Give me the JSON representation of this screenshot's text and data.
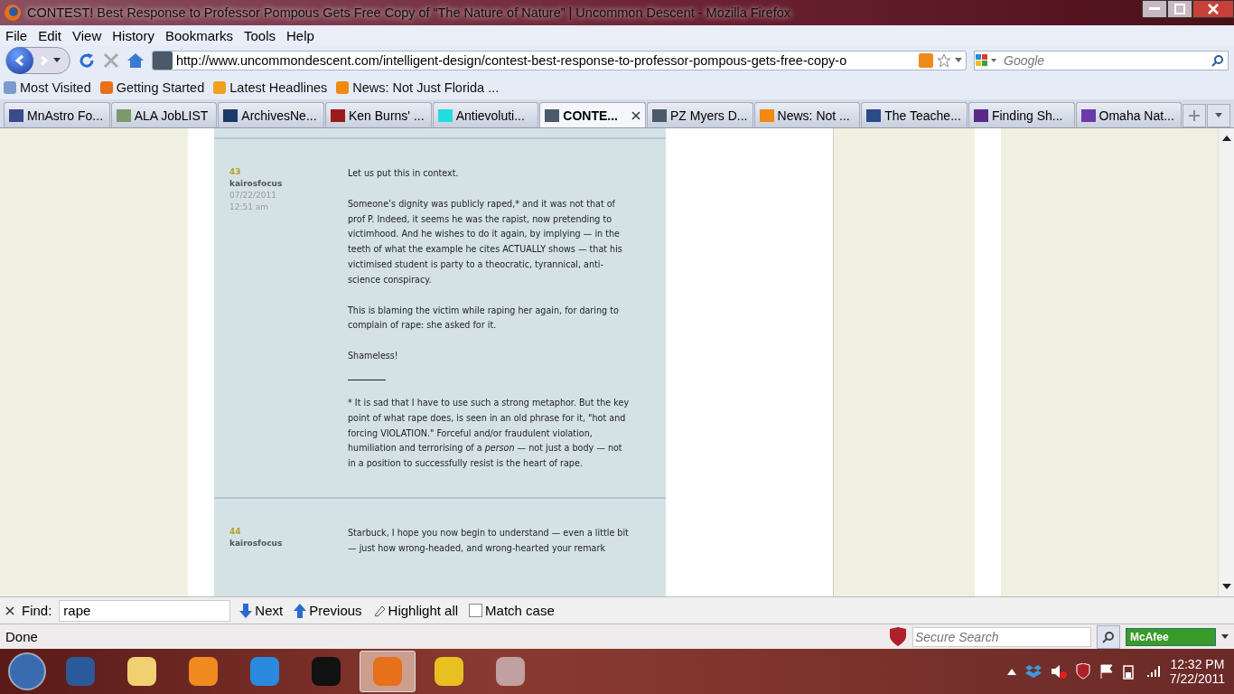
{
  "window": {
    "title": "CONTEST! Best Response to Professor Pompous Gets Free Copy of “The Nature of Nature” | Uncommon Descent - Mozilla Firefox"
  },
  "menu": [
    "File",
    "Edit",
    "View",
    "History",
    "Bookmarks",
    "Tools",
    "Help"
  ],
  "address": {
    "url": "http://www.uncommondescent.com/intelligent-design/contest-best-response-to-professor-pompous-gets-free-copy-o"
  },
  "search": {
    "placeholder": "Google"
  },
  "bookmarks": [
    "Most Visited",
    "Getting Started",
    "Latest Headlines",
    "News: Not Just Florida ..."
  ],
  "tabs": [
    {
      "label": "MnAstro Fo...",
      "selected": false,
      "color": "#3a4a8a"
    },
    {
      "label": "ALA JobLIST",
      "selected": false,
      "color": "#7a9a6a"
    },
    {
      "label": "ArchivesNe...",
      "selected": false,
      "color": "#1a3a6a"
    },
    {
      "label": "Ken Burns' ...",
      "selected": false,
      "color": "#9a1a1a"
    },
    {
      "label": "Antievoluti...",
      "selected": false,
      "color": "#22dddd"
    },
    {
      "label": "CONTE...",
      "selected": true,
      "color": "#4a5a6a"
    },
    {
      "label": "PZ Myers D...",
      "selected": false,
      "color": "#4a5a6a"
    },
    {
      "label": "News: Not ...",
      "selected": false,
      "color": "#f08a10"
    },
    {
      "label": "The Teache...",
      "selected": false,
      "color": "#2a4a8a"
    },
    {
      "label": "Finding Sh...",
      "selected": false,
      "color": "#5a2a8a"
    },
    {
      "label": "Omaha Nat...",
      "selected": false,
      "color": "#6a3aaa"
    }
  ],
  "comments": [
    {
      "number": "43",
      "author": "kairosfocus",
      "date": "07/22/2011",
      "time": "12:51 am",
      "paragraphs": [
        "Let us put this in context.",
        "Someone’s dignity was publicly raped,* and it was not that of prof P. Indeed, it seems he was the rapist, now pretending to victimhood. And he wishes to do it again, by implying — in the teeth of what the example he cites ACTUALLY shows — that his victimised student is party to a theocratic, tyrannical, anti-science conspiracy.",
        "This is blaming the victim while raping her again, for daring to complain of rape: she asked for it.",
        "Shameless!"
      ],
      "footnote": {
        "marker": "*",
        "text": "It is sad that I have to use such a strong metaphor. But the key point of what rape does, is seen in an old phrase for it, \"hot and forcing VIOLATION.\" Forceful and/or fraudulent violation, humiliation and terrorising of a *person* — not just a body — not in a position to successfully resist is the heart of rape."
      }
    },
    {
      "number": "44",
      "author": "kairosfocus",
      "paragraphs": [
        "Starbuck, I hope you now begin to understand — even a little bit — just how wrong-headed, and wrong-hearted your remark"
      ]
    }
  ],
  "find": {
    "label": "Find:",
    "value": "rape",
    "next": "Next",
    "previous": "Previous",
    "highlight": "Highlight all",
    "match_case": {
      "label": "Match case",
      "checked": false
    }
  },
  "status_bar": {
    "text": "Done",
    "secure_search": {
      "placeholder": "Secure Search"
    },
    "mcafee": "McAfee"
  },
  "taskbar": {
    "time": "12:32 PM",
    "date": "7/22/2011"
  }
}
